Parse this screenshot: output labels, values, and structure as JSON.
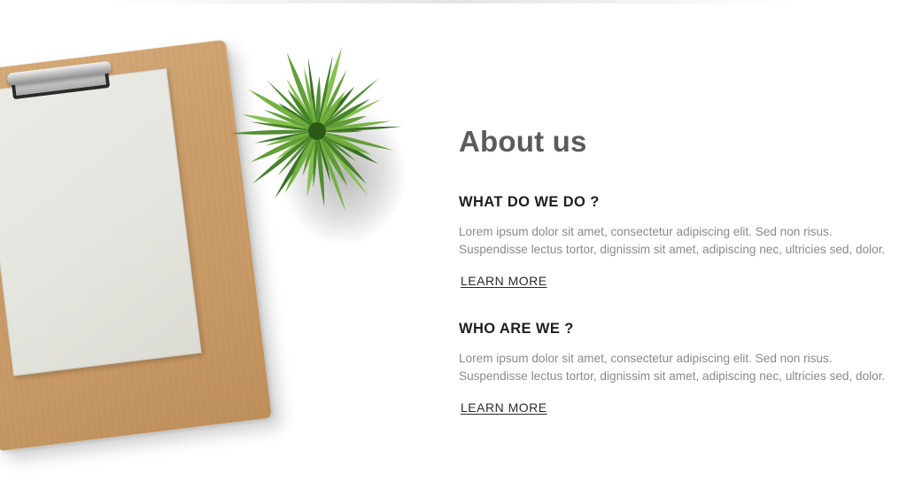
{
  "about": {
    "title": "About us",
    "sections": [
      {
        "heading": "WHAT DO WE DO ?",
        "text_lines": [
          "Lorem ipsum dolor sit amet, consectetur adipiscing elit. Sed non risus.",
          "Suspendisse lectus tortor, dignissim sit amet, adipiscing nec, ultricies sed, dolor."
        ],
        "link_label": "LEARN MORE"
      },
      {
        "heading": "WHO ARE WE ?",
        "text_lines": [
          "Lorem ipsum dolor sit amet, consectetur adipiscing elit. Sed non risus.",
          "Suspendisse lectus tortor, dignissim sit amet, adipiscing nec, ultricies sed, dolor."
        ],
        "link_label": "LEARN MORE"
      }
    ]
  },
  "colors": {
    "title": "#5b5b5b",
    "heading": "#1f1f1f",
    "body_text": "#8a8a8a",
    "link": "#2b2b2b",
    "wood": "#cc9f6c",
    "plant_green": "#4a8a2a"
  },
  "illustration": {
    "items": [
      "clipboard-image",
      "paper-image",
      "plant-image"
    ]
  }
}
